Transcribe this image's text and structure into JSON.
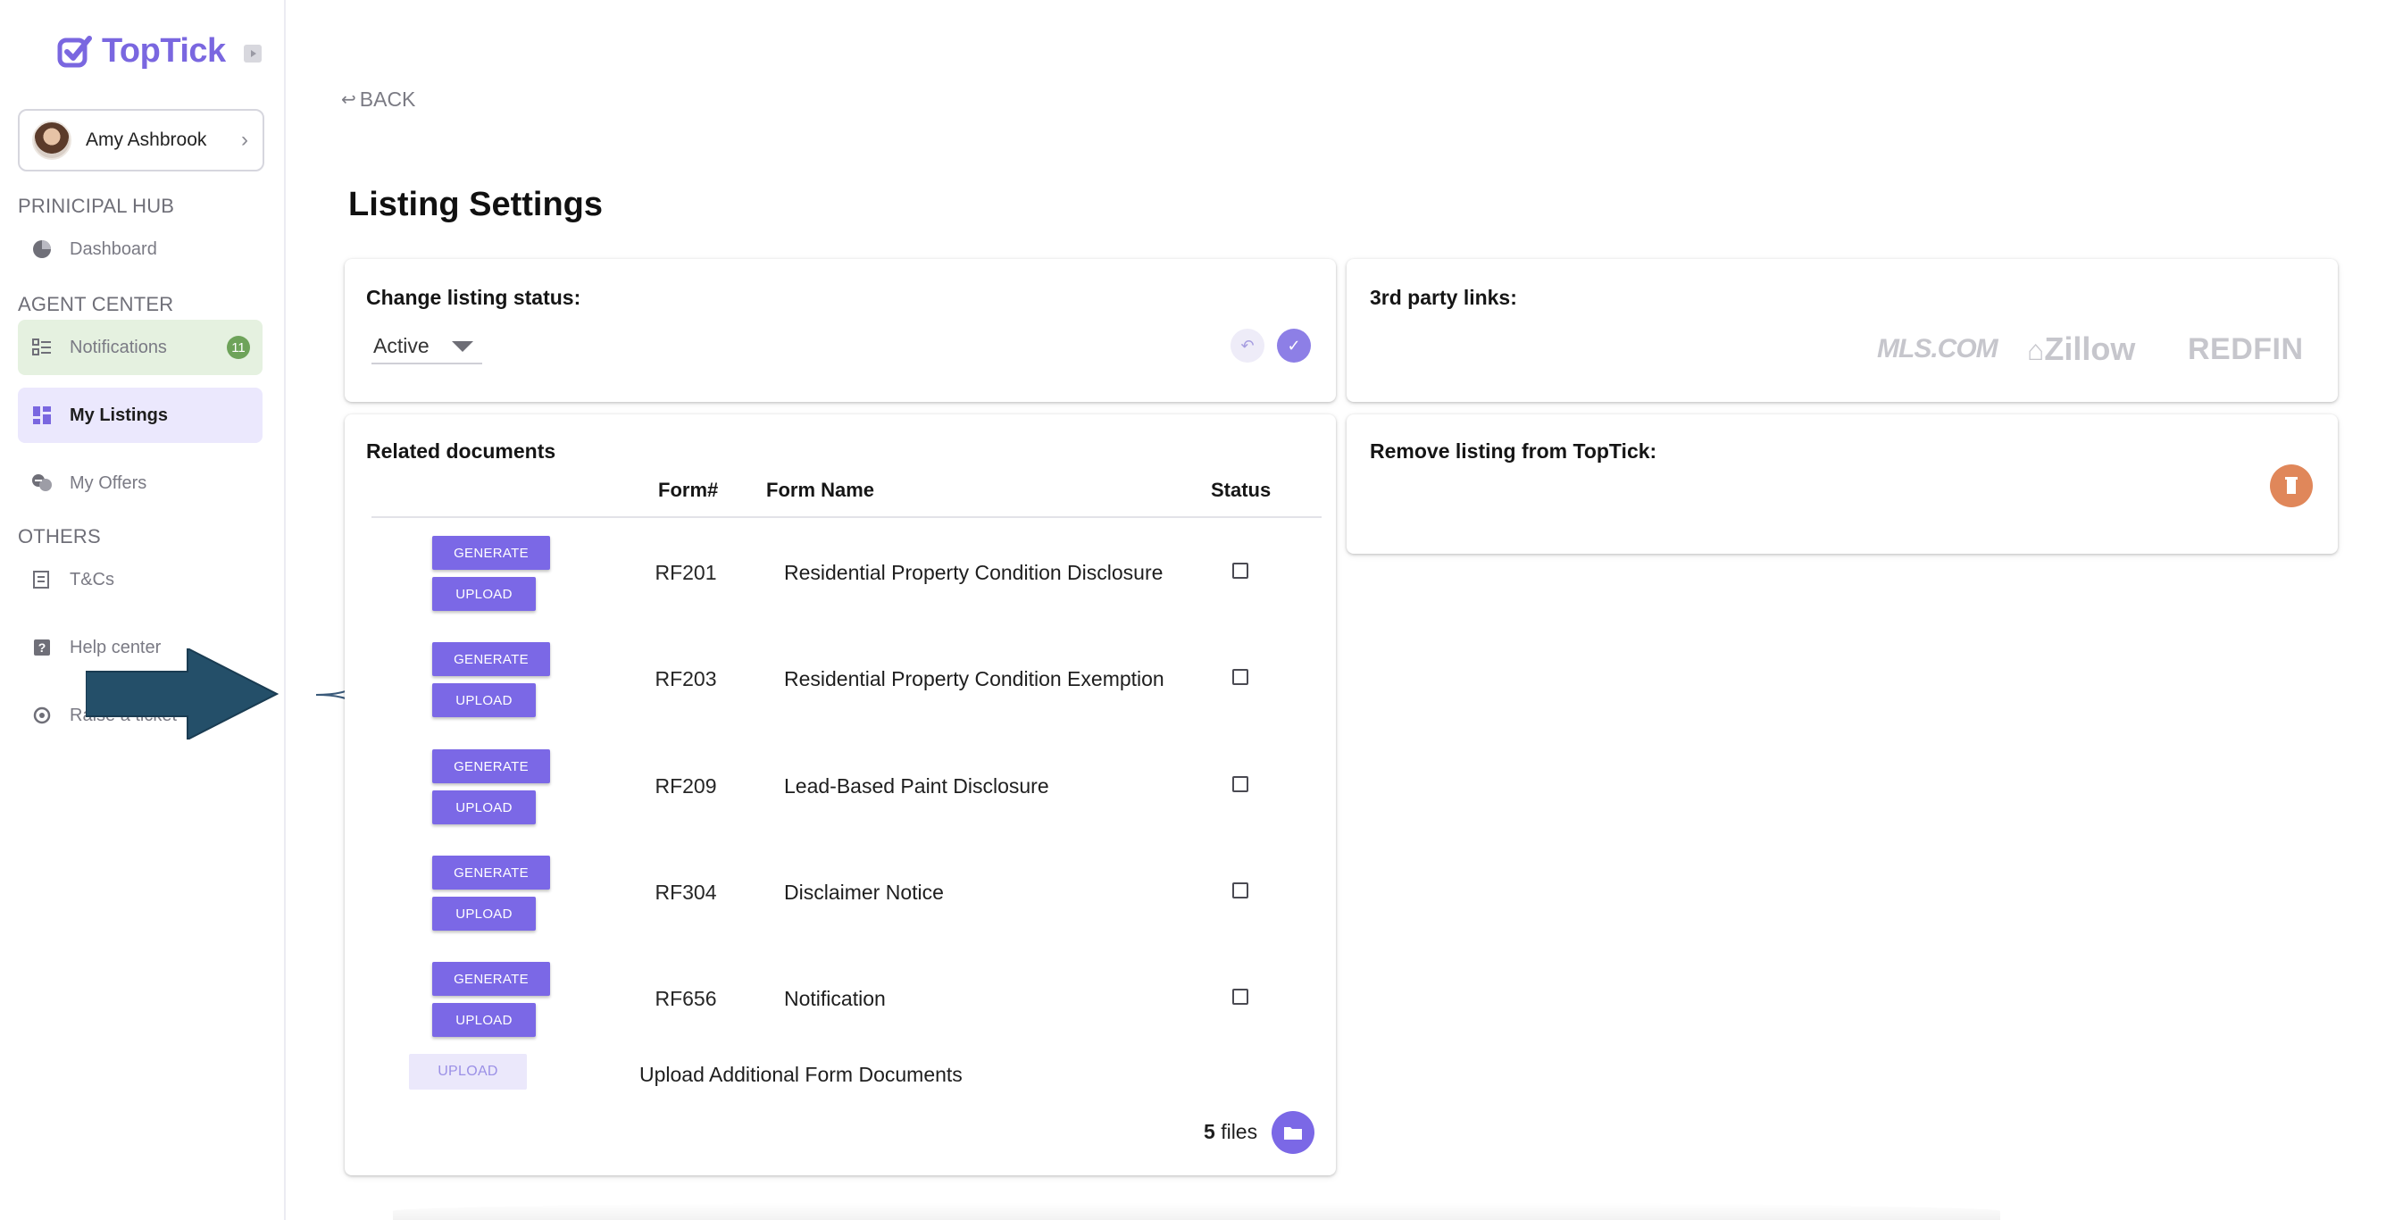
{
  "app": {
    "name": "TopTick"
  },
  "user": {
    "name": "Amy Ashbrook"
  },
  "sidebar": {
    "sections": [
      {
        "title": "PRINICIPAL HUB",
        "items": [
          {
            "label": "Dashboard",
            "icon": "pie-chart-icon"
          }
        ]
      },
      {
        "title": "AGENT CENTER",
        "items": [
          {
            "label": "Notifications",
            "icon": "list-icon",
            "badge": "11"
          },
          {
            "label": "My Listings",
            "icon": "dashboard-grid-icon",
            "active": true
          },
          {
            "label": "My Offers",
            "icon": "handshake-icon"
          }
        ]
      },
      {
        "title": "OTHERS",
        "items": [
          {
            "label": "T&Cs",
            "icon": "document-icon"
          },
          {
            "label": "Help center",
            "icon": "help-icon"
          },
          {
            "label": "Raise a ticket",
            "icon": "ticket-icon"
          }
        ]
      }
    ]
  },
  "nav": {
    "back_label": "BACK"
  },
  "page": {
    "title": "Listing Settings"
  },
  "status_card": {
    "title": "Change listing status:",
    "selected": "Active"
  },
  "links_card": {
    "title": "3rd party links:",
    "brands": [
      "MLS.COM",
      "Zillow",
      "REDFIN"
    ]
  },
  "remove_card": {
    "title": "Remove listing from TopTick:"
  },
  "documents": {
    "title": "Related documents",
    "columns": [
      "Form#",
      "Form Name",
      "Status"
    ],
    "generate_label": "GENERATE",
    "upload_label": "UPLOAD",
    "rows": [
      {
        "form_no": "RF201",
        "form_name": "Residential Property Condition Disclosure"
      },
      {
        "form_no": "RF203",
        "form_name": "Residential Property Condition Exemption"
      },
      {
        "form_no": "RF209",
        "form_name": "Lead-Based Paint Disclosure"
      },
      {
        "form_no": "RF304",
        "form_name": "Disclaimer Notice"
      },
      {
        "form_no": "RF656",
        "form_name": "Notification"
      }
    ],
    "additional_upload_label": "UPLOAD",
    "additional_label": "Upload Additional Form Documents",
    "files_count": "5",
    "files_label": "files"
  },
  "colors": {
    "brand": "#7a67e0",
    "primary_button": "#7b68e6",
    "notification_bg": "#e5f1e0",
    "active_bg": "#ebe8fd",
    "delete": "#e0875a",
    "arrow": "#244f69"
  }
}
